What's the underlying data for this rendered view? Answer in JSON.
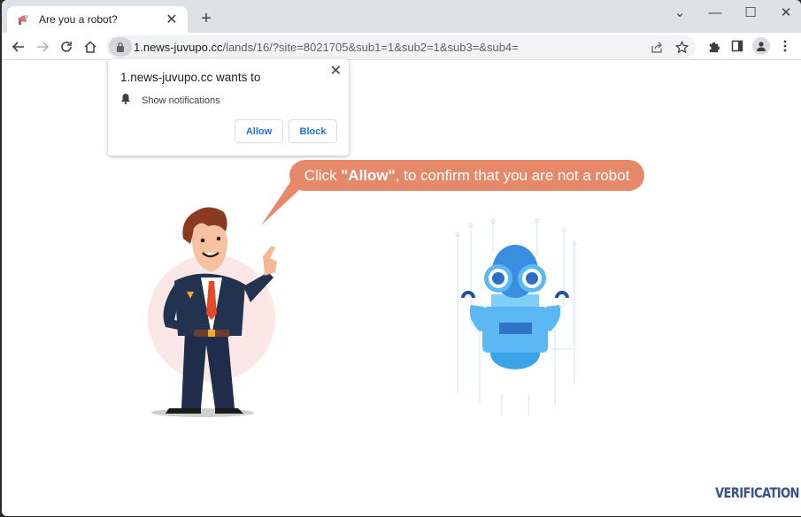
{
  "browser": {
    "tab": {
      "title": "Are you a robot?",
      "favicon": "megaphone-icon"
    },
    "new_tab_label": "+",
    "window_controls": {
      "dropdown": "⌄",
      "minimize": "—",
      "maximize": "☐",
      "close": "✕"
    },
    "url": {
      "host": "1.news-juvupo.cc",
      "path": "/lands/16/?site=8021705&sub1=1&sub2=1&sub3=&sub4="
    }
  },
  "permission_popup": {
    "title": "1.news-juvupo.cc wants to",
    "permission": "Show notifications",
    "allow_label": "Allow",
    "block_label": "Block",
    "close_label": "✕"
  },
  "page": {
    "bubble": {
      "prefix": "Click ",
      "emphasis": "\"Allow\"",
      "suffix": ", to confirm that you are not a robot"
    },
    "brand": "VERIFICATION",
    "colors": {
      "bubble": "#e5896a",
      "brand": "#3a5487",
      "robot": "#3aa3e8",
      "suit": "#22324f"
    }
  }
}
